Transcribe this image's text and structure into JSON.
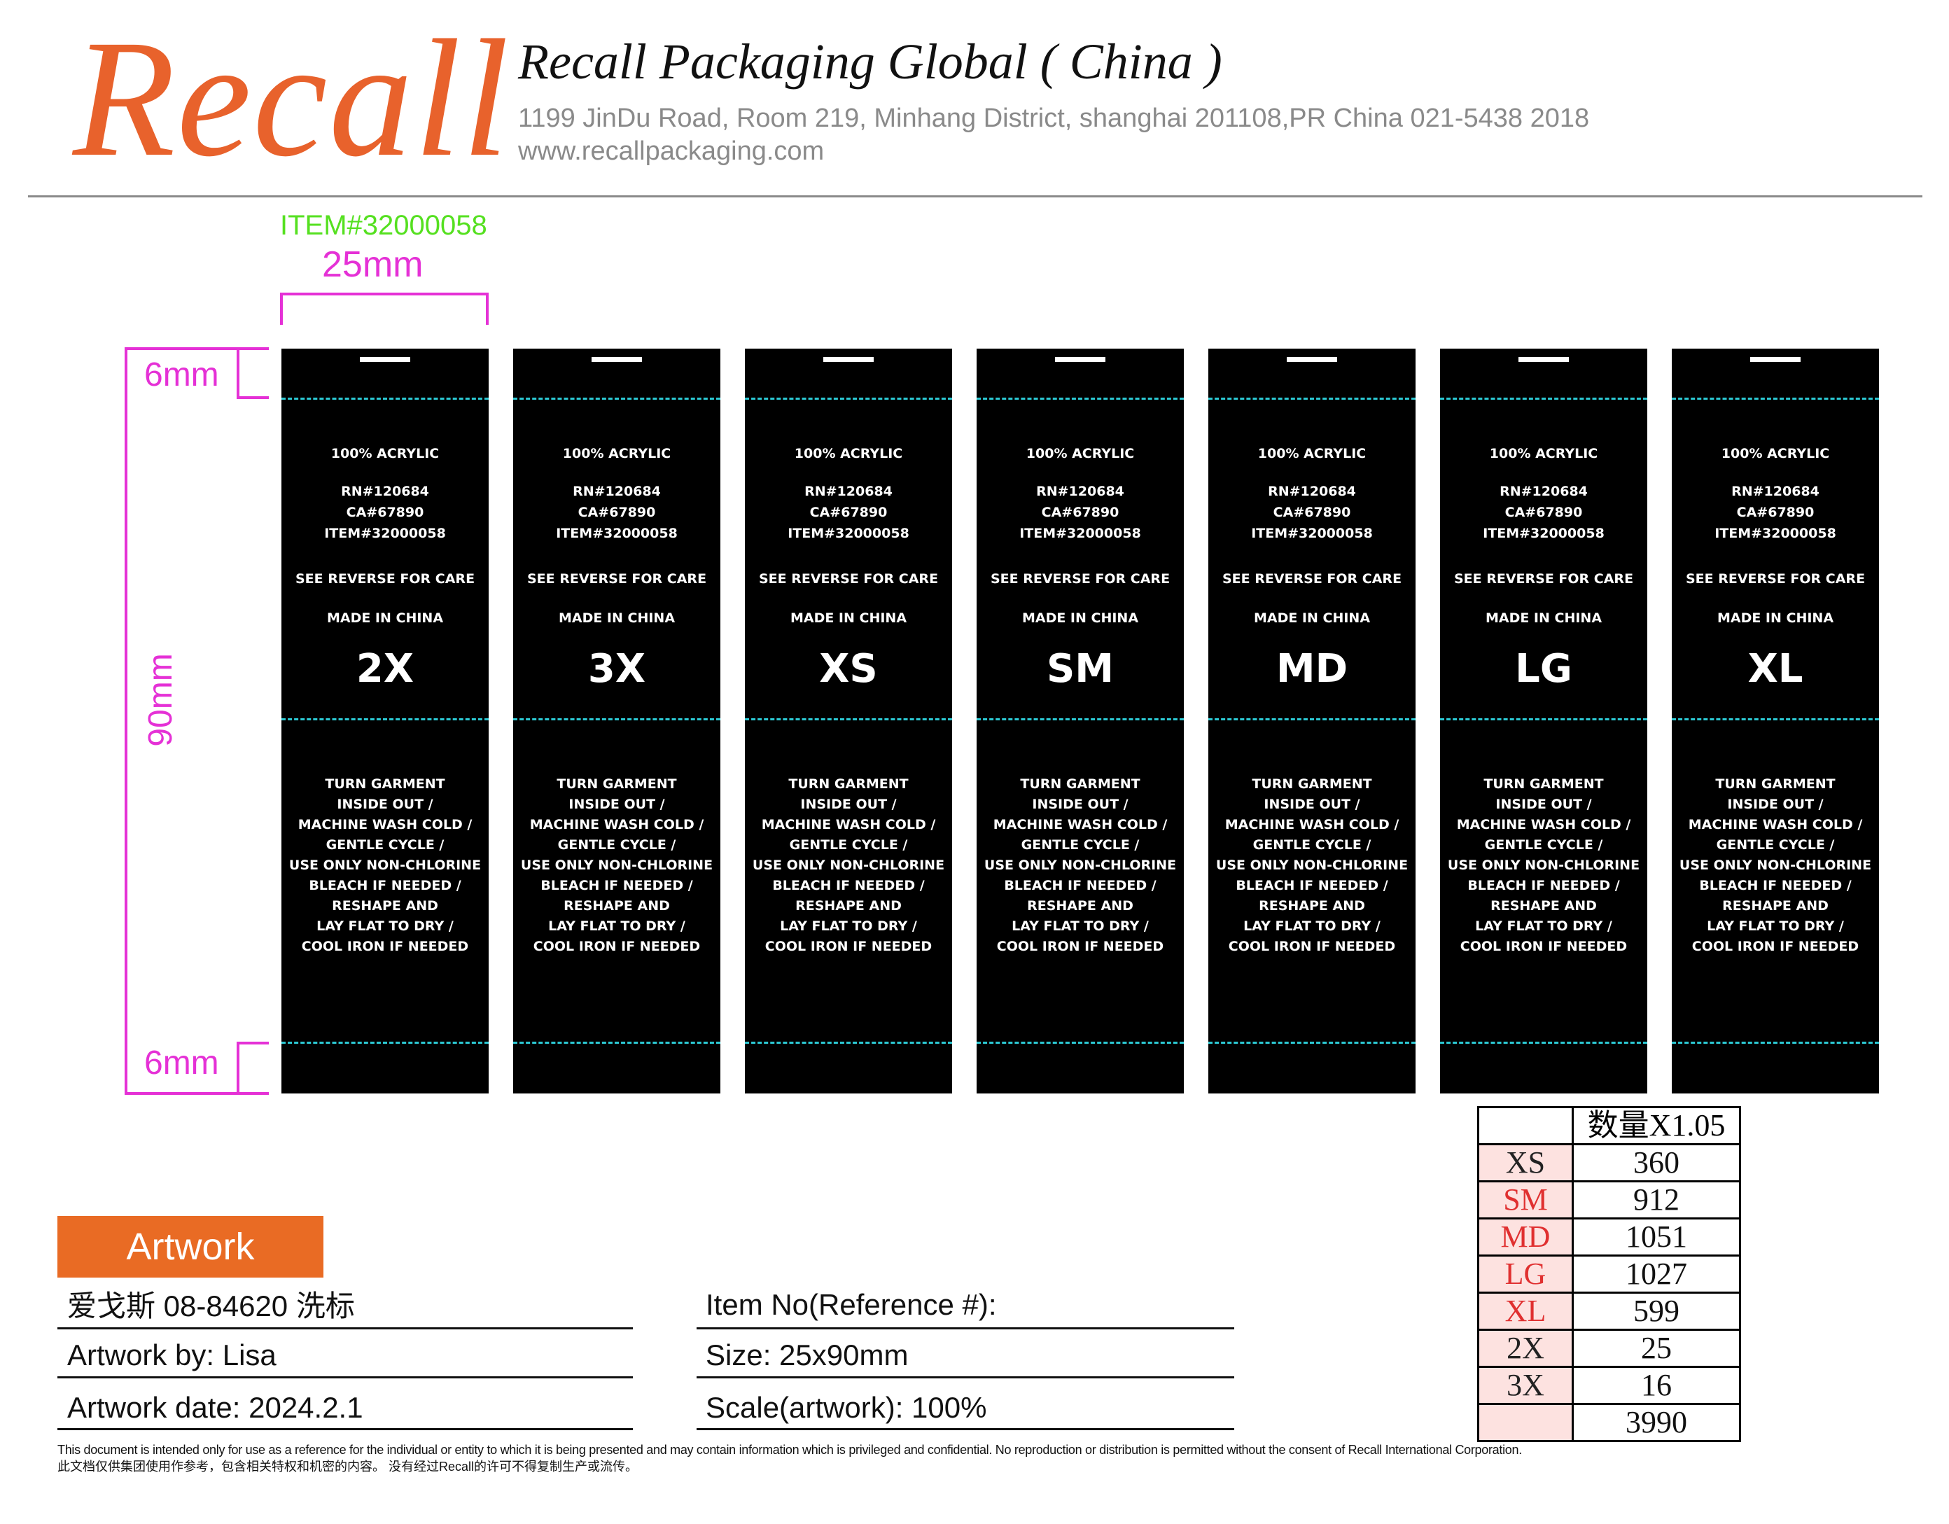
{
  "header": {
    "logo": "Recall",
    "company": "Recall Packaging Global ( China )",
    "address": "1199 JinDu Road, Room 219, Minhang District, shanghai 201108,PR China   021-5438 2018",
    "website": "www.recallpackaging.com"
  },
  "dimensions": {
    "item_id": "ITEM#32000058",
    "width": "25mm",
    "top_margin": "6mm",
    "height": "90mm",
    "bottom_margin": "6mm"
  },
  "label_text": {
    "fiber": "100% ACRYLIC",
    "rn": "RN#120684",
    "ca": "CA#67890",
    "item": "ITEM#32000058",
    "see_reverse": "SEE REVERSE FOR CARE",
    "made_in": "MADE IN CHINA",
    "care": [
      "TURN GARMENT",
      "INSIDE OUT /",
      "MACHINE WASH COLD /",
      "GENTLE CYCLE /",
      "USE ONLY NON-CHLORINE",
      "BLEACH IF NEEDED /",
      "RESHAPE AND",
      "LAY FLAT TO DRY /",
      "COOL IRON IF NEEDED"
    ]
  },
  "labels": [
    {
      "size": "2X"
    },
    {
      "size": "3X"
    },
    {
      "size": "XS"
    },
    {
      "size": "SM"
    },
    {
      "size": "MD"
    },
    {
      "size": "LG"
    },
    {
      "size": "XL"
    }
  ],
  "quantity_table": {
    "header": "数量X1.05",
    "rows": [
      {
        "size": "XS",
        "qty": "360",
        "red": false
      },
      {
        "size": "SM",
        "qty": "912",
        "red": true
      },
      {
        "size": "MD",
        "qty": "1051",
        "red": true
      },
      {
        "size": "LG",
        "qty": "1027",
        "red": true
      },
      {
        "size": "XL",
        "qty": "599",
        "red": true
      },
      {
        "size": "2X",
        "qty": "25",
        "red": false
      },
      {
        "size": "3X",
        "qty": "16",
        "red": false
      }
    ],
    "total": "3990"
  },
  "artwork": {
    "button": "Artwork",
    "name": "爱戈斯 08-84620 洗标",
    "by": "Artwork by:  Lisa",
    "date": "Artwork date: 2024.2.1",
    "item_no": "Item No(Reference #):",
    "size": "Size: 25x90mm",
    "scale": "Scale(artwork): 100%"
  },
  "disclaimer": {
    "en": "This document is intended only for use as a reference for the individual or entity to which it is being presented and may contain information which is privileged and confidential. No reproduction or distribution is permitted without the consent of Recall International Corporation.",
    "zh": "此文档仅供集团使用作参考，包含相关特权和机密的内容。 没有经过Recall的许可不得复制生产或流传。"
  },
  "colors": {
    "brand_orange": "#e8622c",
    "dimension_magenta": "#e531d6",
    "item_green": "#55e020",
    "cut_line_cyan": "#2cc9d4",
    "label_black": "#000000"
  }
}
